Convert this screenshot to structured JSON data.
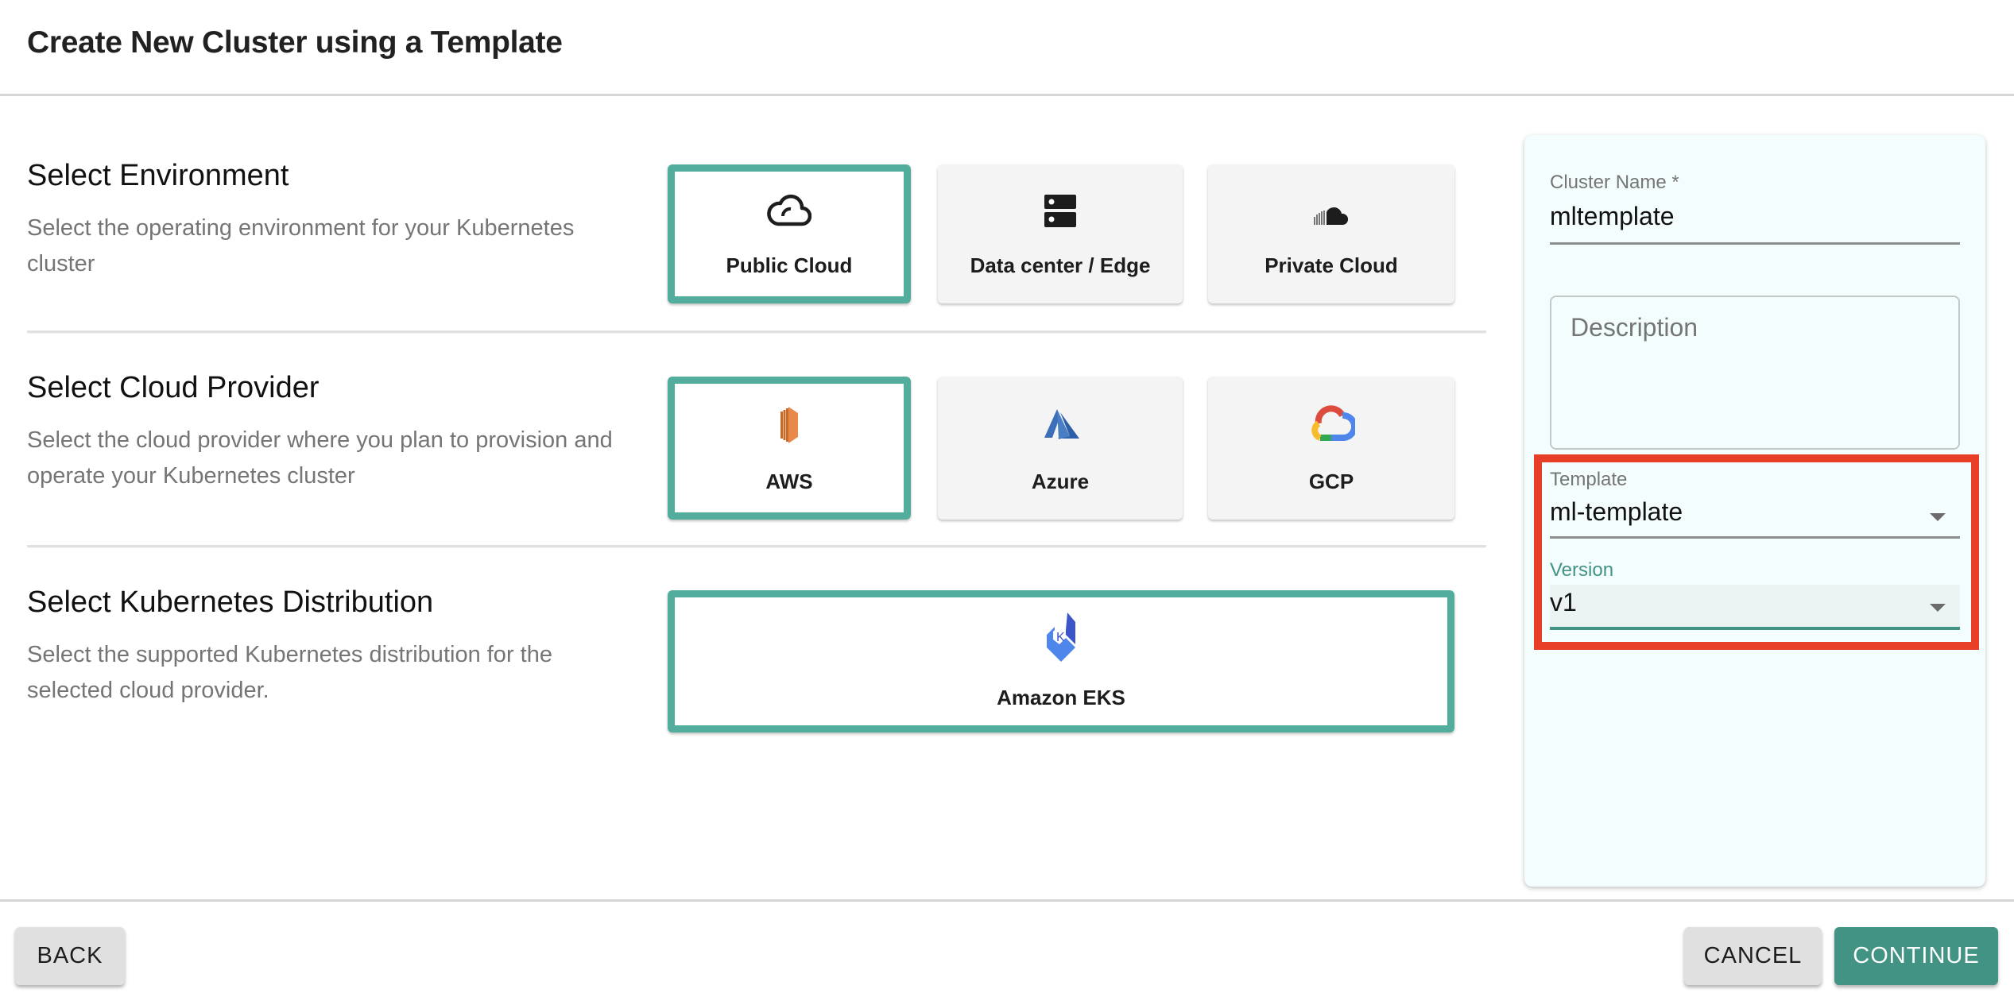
{
  "header": {
    "title": "Create New Cluster using a Template"
  },
  "sections": [
    {
      "heading": "Select Environment",
      "description": "Select the operating environment for your Kubernetes cluster",
      "options": [
        {
          "label": "Public Cloud",
          "icon": "cloud-outline-icon",
          "selected": true
        },
        {
          "label": "Data center / Edge",
          "icon": "server-icon",
          "selected": false
        },
        {
          "label": "Private Cloud",
          "icon": "private-cloud-icon",
          "selected": false
        }
      ]
    },
    {
      "heading": "Select Cloud Provider",
      "description": "Select the cloud provider where you plan to provision and operate your Kubernetes cluster",
      "options": [
        {
          "label": "AWS",
          "icon": "aws-icon",
          "selected": true
        },
        {
          "label": "Azure",
          "icon": "azure-icon",
          "selected": false
        },
        {
          "label": "GCP",
          "icon": "gcp-icon",
          "selected": false
        }
      ]
    },
    {
      "heading": "Select Kubernetes Distribution",
      "description": "Select the supported Kubernetes distribution for the selected cloud provider.",
      "options": [
        {
          "label": "Amazon EKS",
          "icon": "eks-icon",
          "selected": true
        }
      ]
    }
  ],
  "form": {
    "cluster_name": {
      "label": "Cluster Name *",
      "value": "mltemplate"
    },
    "description": {
      "placeholder": "Description",
      "value": ""
    },
    "template": {
      "label": "Template",
      "value": "ml-template"
    },
    "version": {
      "label": "Version",
      "value": "v1"
    }
  },
  "footer": {
    "back_label": "BACK",
    "cancel_label": "CANCEL",
    "continue_label": "CONTINUE"
  },
  "colors": {
    "accent": "#52ad9c",
    "primary_button": "#429384",
    "highlight": "#e63e27",
    "panel_bg": "#f4fdfd"
  }
}
